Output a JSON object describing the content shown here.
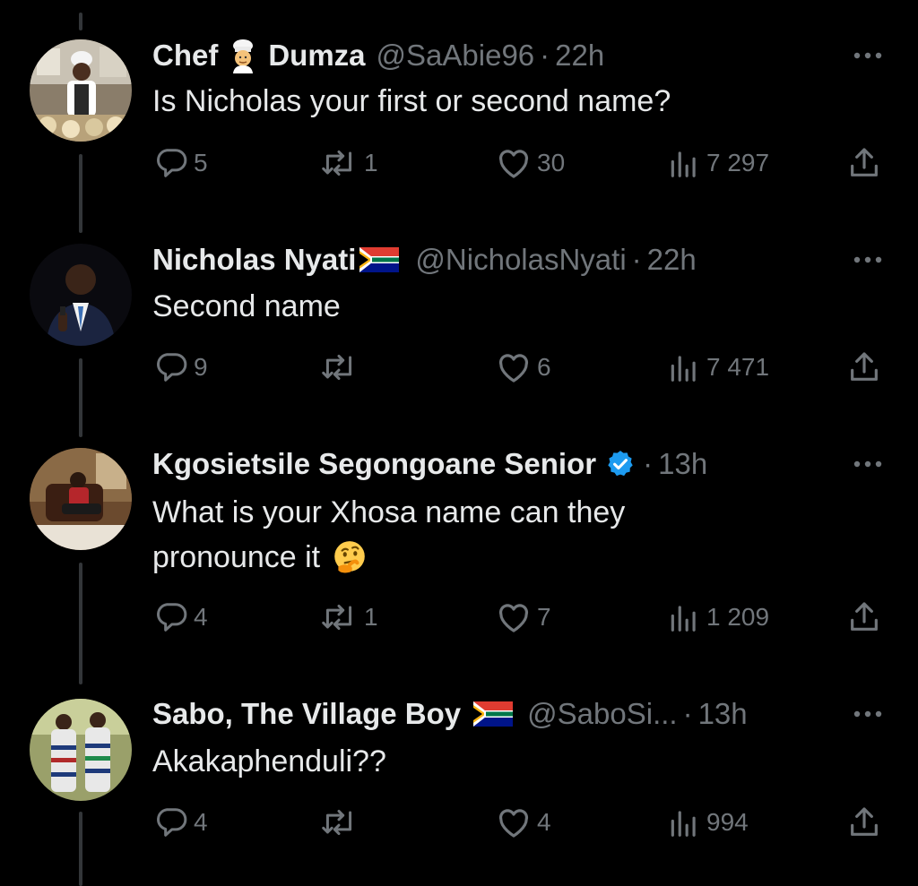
{
  "thread": [
    {
      "name_parts": [
        "Chef",
        "Dumza"
      ],
      "name_emoji": "chef-emoji",
      "handle": "@SaAbie96",
      "separator": "·",
      "time": "22h",
      "text": "Is Nicholas your first or second name?",
      "replies": "5",
      "reposts": "1",
      "likes": "30",
      "views": "7 297"
    },
    {
      "name": "Nicholas Nyati",
      "name_emoji": "south-africa-flag",
      "handle": "@NicholasNyati",
      "separator": "·",
      "time": "22h",
      "text": "Second name",
      "replies": "9",
      "reposts": "",
      "likes": "6",
      "views": "7 471"
    },
    {
      "name": "Kgosietsile Segongoane Senior",
      "name_emoji": "verified-badge",
      "handle": "",
      "separator": "·",
      "time": "13h",
      "text_line1": "What is your Xhosa name can they",
      "text_line2": "pronounce it",
      "text_emoji": "thinking-face-emoji",
      "replies": "4",
      "reposts": "1",
      "likes": "7",
      "views": "1 209"
    },
    {
      "name": "Sabo, The Village Boy",
      "name_emoji": "south-africa-flag",
      "handle": "@SaboSi...",
      "separator": "·",
      "time": "13h",
      "text": "Akakaphenduli??",
      "replies": "4",
      "reposts": "",
      "likes": "4",
      "views": "994"
    }
  ],
  "colors": {
    "background": "#000000",
    "primary_text": "#e7e9ea",
    "secondary_text": "#71767b",
    "thread_line": "#333639",
    "verified_blue": "#1d9bf0"
  }
}
